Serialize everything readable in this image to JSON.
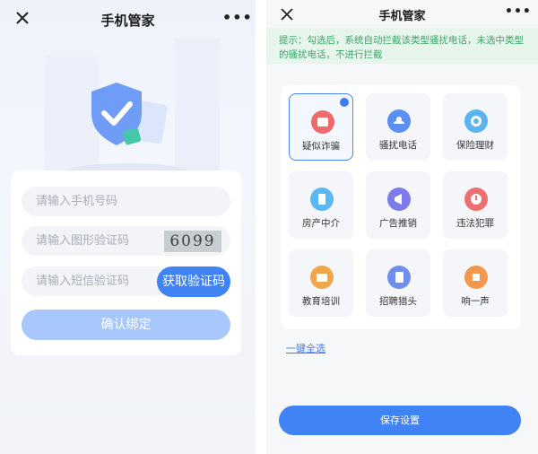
{
  "left": {
    "title": "手机管家",
    "more_label": "•••",
    "phone_placeholder": "请输入手机号码",
    "captcha_placeholder": "请输入图形验证码",
    "captcha_text": "6099",
    "sms_placeholder": "请输入短信验证码",
    "sms_button": "获取验证码",
    "confirm_button": "确认绑定"
  },
  "right": {
    "title": "手机管家",
    "more_label": "•••",
    "tip": "提示：勾选后，系统自动拦截该类型骚扰电话，未选中类型的骚扰电话，不进行拦截",
    "categories": [
      {
        "label": "疑似诈骗",
        "icon": "fraud-icon",
        "color": "#ef6b6b",
        "selected": true
      },
      {
        "label": "骚扰电话",
        "icon": "phone-icon",
        "color": "#5b8ff3",
        "selected": false
      },
      {
        "label": "保险理财",
        "icon": "coin-icon",
        "color": "#5bb3f0",
        "selected": false
      },
      {
        "label": "房产中介",
        "icon": "building-icon",
        "color": "#5cb8f2",
        "selected": false
      },
      {
        "label": "广告推销",
        "icon": "megaphone-icon",
        "color": "#7d7bea",
        "selected": false
      },
      {
        "label": "违法犯罪",
        "icon": "warning-icon",
        "color": "#ee6f6f",
        "selected": false
      },
      {
        "label": "教育培训",
        "icon": "book-icon",
        "color": "#f2a64c",
        "selected": false
      },
      {
        "label": "招聘猎头",
        "icon": "document-icon",
        "color": "#6f8ff0",
        "selected": false
      },
      {
        "label": "响一声",
        "icon": "ring-icon",
        "color": "#f2974e",
        "selected": false
      }
    ],
    "select_all": "一键全选",
    "save_button": "保存设置"
  }
}
